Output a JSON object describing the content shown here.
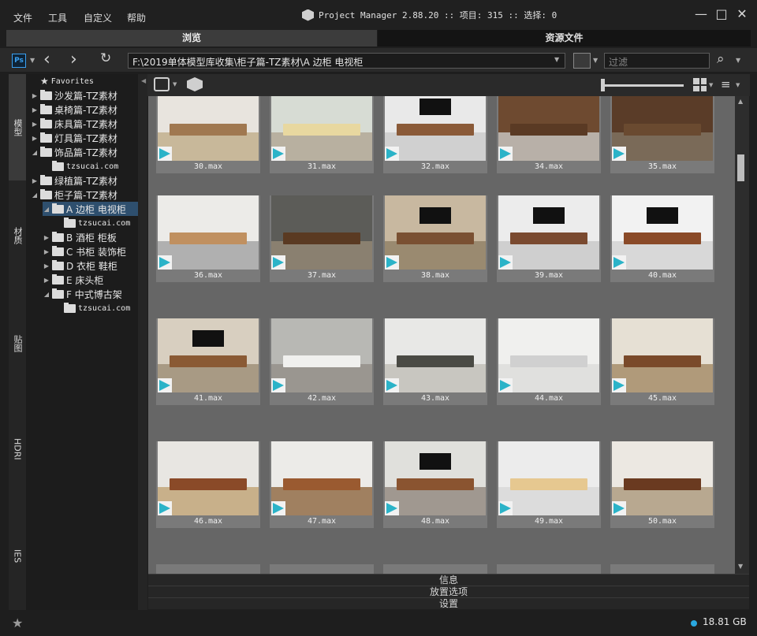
{
  "menu": [
    "文件",
    "工具",
    "自定义",
    "帮助"
  ],
  "app_title": "Project Manager 2.88.20 :: 项目: 315 :: 选择: 0",
  "window_controls": {
    "minimize": "—",
    "maximize": "□",
    "close": "✕"
  },
  "tabs": [
    "浏览",
    "资源文件"
  ],
  "toolbar": {
    "ps_label": "Ps",
    "path": "F:\\2019单体模型库收集\\柜子篇-TZ素材\\A 边柜 电视柜",
    "filter_placeholder": "过滤"
  },
  "left_tabs": [
    "模型",
    "材质",
    "贴图",
    "HDRI",
    "IES"
  ],
  "tree": [
    {
      "label": "Favorites",
      "indent": 0,
      "type": "star",
      "mono": true
    },
    {
      "label": "沙发篇-TZ素材",
      "indent": 0,
      "type": "folder"
    },
    {
      "label": "桌椅篇-TZ素材",
      "indent": 0,
      "type": "folder"
    },
    {
      "label": "床具篇-TZ素材",
      "indent": 0,
      "type": "folder"
    },
    {
      "label": "灯具篇-TZ素材",
      "indent": 0,
      "type": "folder"
    },
    {
      "label": "饰品篇-TZ素材",
      "indent": 0,
      "type": "folder",
      "open": true
    },
    {
      "label": "tzsucai.com",
      "indent": 1,
      "type": "folder",
      "leaf": true,
      "mono": true
    },
    {
      "label": "绿植篇-TZ素材",
      "indent": 0,
      "type": "folder"
    },
    {
      "label": "柜子篇-TZ素材",
      "indent": 0,
      "type": "folder",
      "open": true
    },
    {
      "label": "A 边柜 电视柜",
      "indent": 1,
      "type": "folder",
      "open": true,
      "selected": true
    },
    {
      "label": "tzsucai.com",
      "indent": 2,
      "type": "folder",
      "leaf": true,
      "mono": true
    },
    {
      "label": "B 酒柜 柜板",
      "indent": 1,
      "type": "folder"
    },
    {
      "label": "C 书柜 装饰柜",
      "indent": 1,
      "type": "folder"
    },
    {
      "label": "D 衣柜 鞋柜",
      "indent": 1,
      "type": "folder"
    },
    {
      "label": "E 床头柜",
      "indent": 1,
      "type": "folder"
    },
    {
      "label": "F 中式博古架",
      "indent": 1,
      "type": "folder",
      "open": true
    },
    {
      "label": "tzsucai.com",
      "indent": 2,
      "type": "folder",
      "leaf": true,
      "mono": true
    }
  ],
  "items": [
    {
      "name": "30.max",
      "wall": "#e8e4de",
      "floor": "#c8b89a",
      "cab": "#a07850",
      "tv": false
    },
    {
      "name": "31.max",
      "wall": "#d7dcd4",
      "floor": "#b8b0a0",
      "cab": "#e8d8a0",
      "tv": false
    },
    {
      "name": "32.max",
      "wall": "#e9e9e9",
      "floor": "#d0d0d0",
      "cab": "#8a5a38",
      "tv": true
    },
    {
      "name": "34.max",
      "wall": "#6e4a30",
      "floor": "#b8b0a8",
      "cab": "#5a3a24",
      "tv": false
    },
    {
      "name": "35.max",
      "wall": "#5a3c28",
      "floor": "#7a6a58",
      "cab": "#6a4a30",
      "tv": false
    },
    {
      "name": "36.max",
      "wall": "#ecebe8",
      "floor": "#b0b0b0",
      "cab": "#c09060",
      "tv": false
    },
    {
      "name": "37.max",
      "wall": "#5c5c58",
      "floor": "#8a8070",
      "cab": "#5a3a22",
      "tv": false
    },
    {
      "name": "38.max",
      "wall": "#c8b8a0",
      "floor": "#9a8a70",
      "cab": "#7a5032",
      "tv": true
    },
    {
      "name": "39.max",
      "wall": "#ececec",
      "floor": "#cfcfcf",
      "cab": "#7a4a30",
      "tv": true
    },
    {
      "name": "40.max",
      "wall": "#f2f2f2",
      "floor": "#d8d8d8",
      "cab": "#8a4a28",
      "tv": true
    },
    {
      "name": "41.max",
      "wall": "#d8cfc0",
      "floor": "#a89a84",
      "cab": "#8a5a34",
      "tv": true
    },
    {
      "name": "42.max",
      "wall": "#b8b8b4",
      "floor": "#9a9690",
      "cab": "#f0f0ee",
      "tv": false
    },
    {
      "name": "43.max",
      "wall": "#e8e8e6",
      "floor": "#c8c6c0",
      "cab": "#4a4a44",
      "tv": false
    },
    {
      "name": "44.max",
      "wall": "#f0f0ee",
      "floor": "#e0e0de",
      "cab": "#d0d0d0",
      "tv": false
    },
    {
      "name": "45.max",
      "wall": "#e6e0d4",
      "floor": "#b09a7a",
      "cab": "#7a4a2a",
      "tv": false
    },
    {
      "name": "46.max",
      "wall": "#e8e6e2",
      "floor": "#c8b08a",
      "cab": "#8a4a28",
      "tv": false
    },
    {
      "name": "47.max",
      "wall": "#ecebe8",
      "floor": "#a08060",
      "cab": "#9a5a30",
      "tv": false
    },
    {
      "name": "48.max",
      "wall": "#e0e0dc",
      "floor": "#a09890",
      "cab": "#8a5430",
      "tv": true
    },
    {
      "name": "49.max",
      "wall": "#ececec",
      "floor": "#dcdcdc",
      "cab": "#e6c890",
      "tv": false
    },
    {
      "name": "50.max",
      "wall": "#ece8e2",
      "floor": "#b8a890",
      "cab": "#6a3a20",
      "tv": false
    }
  ],
  "panels": [
    "信息",
    "放置选项",
    "设置"
  ],
  "status": {
    "disk": "18.81 GB",
    "disk_color": "#2aa8e0"
  },
  "accent": "#2e4f6e"
}
